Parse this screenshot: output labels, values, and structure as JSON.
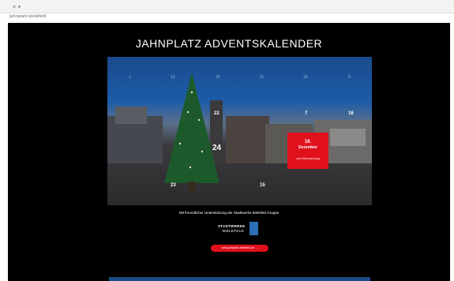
{
  "browser": {
    "tab_close": "×",
    "tab_plus": "+",
    "url": "jahnplatz-bielefeld"
  },
  "page": {
    "title": "JAHNPLATZ ADVENTSKALENDER",
    "calendar": {
      "doors": [
        "1",
        "13",
        "20",
        "11",
        "18",
        "8",
        "22",
        "7",
        "16",
        "24",
        "15",
        "23"
      ],
      "open_door": {
        "day": "19.",
        "month": "Dezember",
        "subtitle": "zum Überraschung"
      }
    },
    "sponsor": {
      "text": "Mit freundlicher Unterstützung der Stadtwerke Bielefeld Gruppe",
      "logo_word1": "STADTWERKE",
      "logo_word2": "BIELEFELD"
    },
    "link_button": "www.jahnplatz-bielefeld.de →"
  },
  "colors": {
    "background": "#000000",
    "accent": "#e0101c",
    "logo_blue": "#2b6fb7"
  }
}
